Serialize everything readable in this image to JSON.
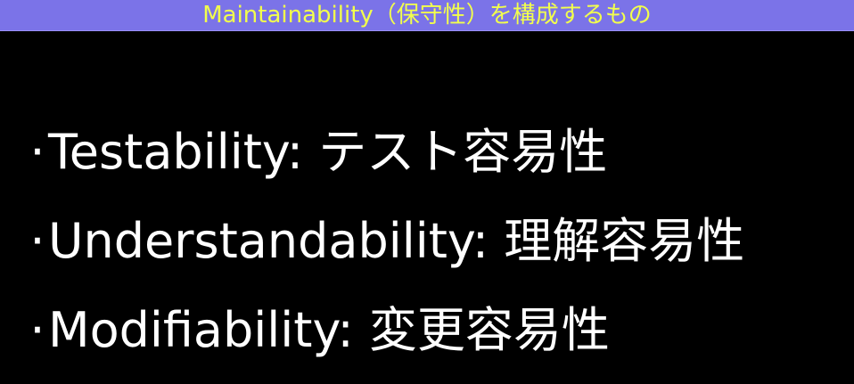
{
  "slide": {
    "title": "Maintainability（保守性）を構成するもの",
    "bullet_marker": "·",
    "bullets": [
      "Testability: テスト容易性",
      "Understandability: 理解容易性",
      "Modifiability: 変更容易性"
    ]
  },
  "colors": {
    "background": "#000000",
    "title_bar": "#7b73e8",
    "title_text": "#f2ff4c",
    "body_text": "#ffffff"
  }
}
